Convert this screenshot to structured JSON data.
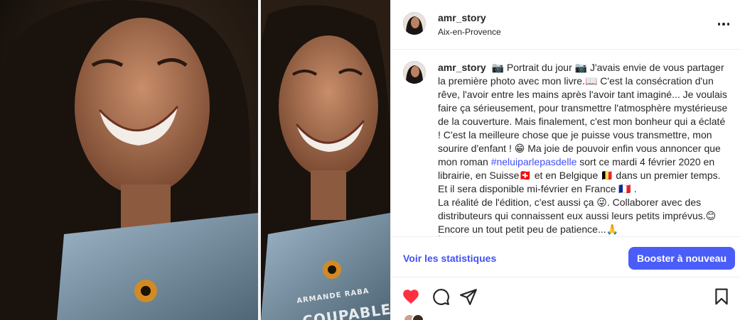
{
  "post": {
    "username": "amr_story",
    "location": "Aix-en-Provence"
  },
  "header": {
    "more_icon": "more-horizontal-icon"
  },
  "caption": {
    "username": "amr_story",
    "part1": "📷 Portrait du jour 📷 J'avais envie de vous partager la première photo avec mon livre.📖 C'est la consécration d'un rêve, l'avoir entre les mains après l'avoir tant imaginé... Je voulais faire ça sérieusement, pour transmettre l'atmosphère mystérieuse de la couverture. Mais finalement, c'est mon bonheur qui a éclaté ! C'est la meilleure chose que je puisse vous transmettre, mon sourire d'enfant ! 😁 Ma joie de pouvoir enfin vous annoncer que mon roman ",
    "hashtag": "#neluiparlepasdelle",
    "part2": " sort ce mardi 4 février 2020 en librairie, en Suisse🇨🇭 et en Belgique 🇧🇪 dans un premier temps. Et il sera disponible mi-février en France 🇫🇷 .\nLa réalité de l'édition, c'est aussi ça 😜. Collaborer avec des distributeurs qui connaissent eux aussi leurs petits imprévus.😊 Encore un tout petit peu de patience...🙏",
    "trailing": "."
  },
  "actions": {
    "stats_label": "Voir les statistiques",
    "boost_label": "Booster à nouveau"
  },
  "icons": {
    "like": "heart-filled-icon",
    "comment": "comment-icon",
    "share": "share-paper-plane-icon",
    "save": "bookmark-icon"
  },
  "media": {
    "book_title": "COUPABLE",
    "book_author": "ARMANDE RABA"
  },
  "colors": {
    "like_red": "#ff3040",
    "link_blue": "#4150f7",
    "button_blue": "#4a5df9"
  }
}
